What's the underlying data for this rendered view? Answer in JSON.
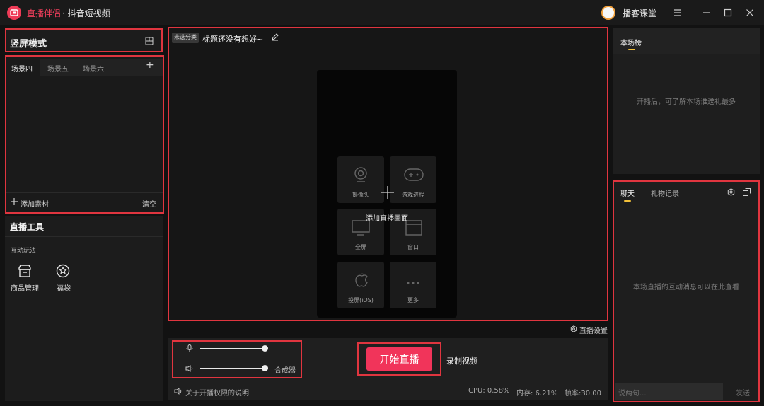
{
  "titlebar": {
    "app_name": "直播伴侣",
    "app_sub": "· 抖音短视频",
    "course_label": "播客课堂",
    "menu_icon": "hamburger-icon",
    "minimize_icon": "minimize-icon",
    "maximize_icon": "maximize-icon",
    "close_icon": "close-icon"
  },
  "left": {
    "mode_title": "竖屏模式",
    "scene_tabs": [
      "场景四",
      "场景五",
      "场景六"
    ],
    "add_scene": "+",
    "add_material": "添加素材",
    "clear": "清空",
    "tools_title": "直播工具",
    "interactive_title": "互动玩法",
    "tools": [
      {
        "label": "商品管理",
        "icon": "store-icon"
      },
      {
        "label": "福袋",
        "icon": "lucky-bag-icon"
      }
    ]
  },
  "canvas": {
    "category_badge": "未选分类",
    "stream_title": "标题还没有想好~",
    "add_scene_label": "添加直播画面",
    "sources": [
      {
        "label": "摄像头",
        "icon": "camera-icon"
      },
      {
        "label": "游戏进程",
        "icon": "gamepad-icon"
      },
      {
        "label": "全屏",
        "icon": "monitor-icon"
      },
      {
        "label": "窗口",
        "icon": "window-icon"
      },
      {
        "label": "投屏(iOS)",
        "icon": "apple-icon"
      },
      {
        "label": "更多",
        "icon": "more-icon"
      }
    ],
    "live_settings": "直播设置"
  },
  "controls": {
    "mic_level": 0.99,
    "speaker_level": 0.99,
    "mixer_label": "合成器",
    "start_label": "开始直播",
    "record_label": "录制视频",
    "permission_note": "关于开播权限的说明",
    "cpu": "CPU: 0.58%",
    "memory": "内存: 6.21%",
    "framerate": "帧率:30.00"
  },
  "right": {
    "rank_title": "本场榜",
    "rank_empty": "开播后，可了解本场谁送礼最多",
    "chat_tab": "聊天",
    "gift_tab": "礼物记录",
    "chat_empty": "本场直播的互动消息可以在此查看",
    "chat_placeholder": "说两句...",
    "send_label": "发送"
  },
  "colors": {
    "accent": "#f1345a",
    "highlight_box": "#e0353f",
    "tab_underline": "#f3c13a",
    "bg": "#121212"
  }
}
